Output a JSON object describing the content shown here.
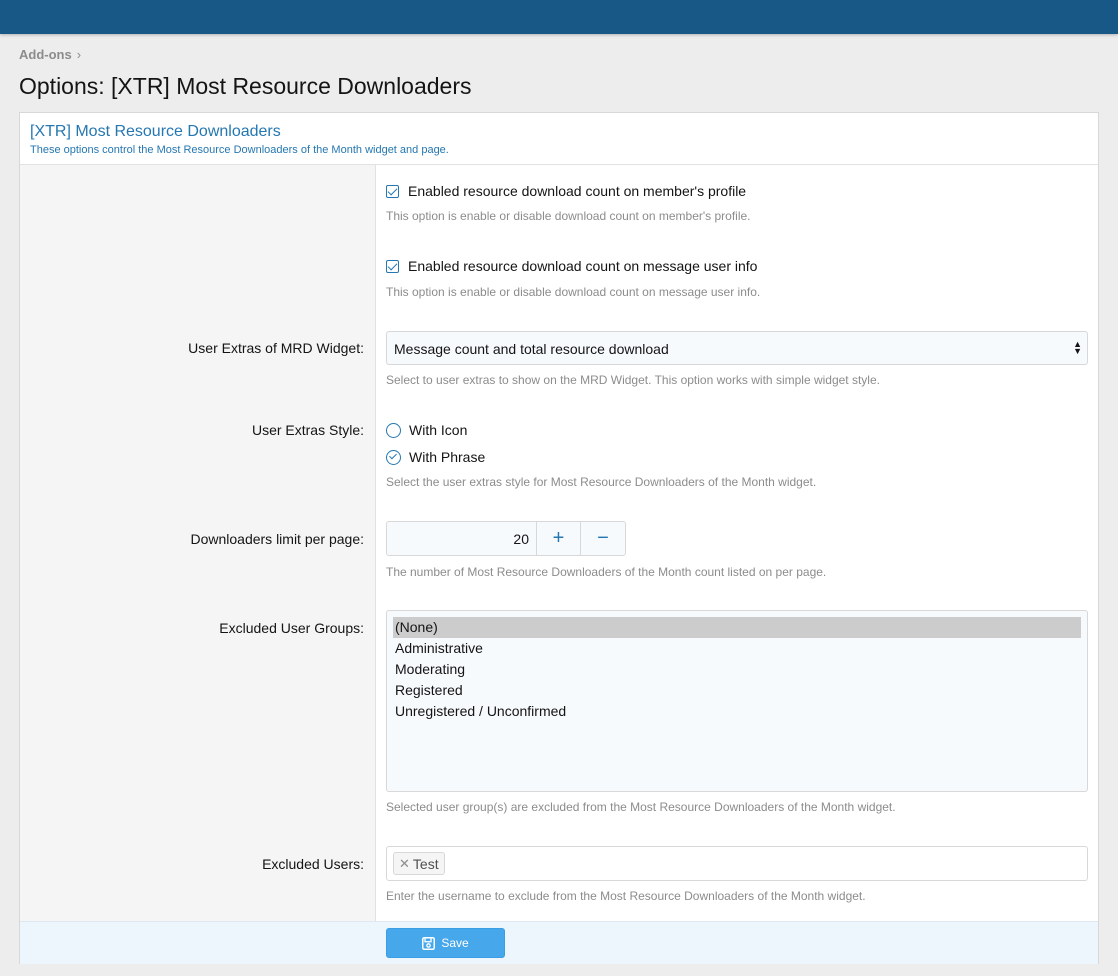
{
  "breadcrumb": {
    "item": "Add-ons"
  },
  "page": {
    "title": "Options: [XTR] Most Resource Downloaders"
  },
  "block": {
    "title": "[XTR] Most Resource Downloaders",
    "description": "These options control the Most Resource Downloaders of the Month widget and page."
  },
  "options": {
    "profile_count": {
      "label": "Enabled resource download count on member's profile",
      "checked": true,
      "hint": "This option is enable or disable download count on member's profile."
    },
    "message_count": {
      "label": "Enabled resource download count on message user info",
      "checked": true,
      "hint": "This option is enable or disable download count on message user info."
    },
    "user_extras": {
      "label": "User Extras of MRD Widget:",
      "value": "Message count and total resource download",
      "hint": "Select to user extras to show on the MRD Widget. This option works with simple widget style."
    },
    "extras_style": {
      "label": "User Extras Style:",
      "options": [
        "With Icon",
        "With Phrase"
      ],
      "selected": "With Phrase",
      "hint": "Select the user extras style for Most Resource Downloaders of the Month widget."
    },
    "limit": {
      "label": "Downloaders limit per page:",
      "value": "20",
      "hint": "The number of Most Resource Downloaders of the Month count listed on per page."
    },
    "excluded_groups": {
      "label": "Excluded User Groups:",
      "options": [
        "(None)",
        "Administrative",
        "Moderating",
        "Registered",
        "Unregistered / Unconfirmed"
      ],
      "selected": "(None)",
      "hint": "Selected user group(s) are excluded from the Most Resource Downloaders of the Month widget."
    },
    "excluded_users": {
      "label": "Excluded Users:",
      "tokens": [
        "Test"
      ],
      "hint": "Enter the username to exclude from the Most Resource Downloaders of the Month widget."
    }
  },
  "actions": {
    "save_label": "Save"
  },
  "colors": {
    "topbar": "#185886",
    "accent": "#2577b1",
    "button": "#47a7eb"
  }
}
